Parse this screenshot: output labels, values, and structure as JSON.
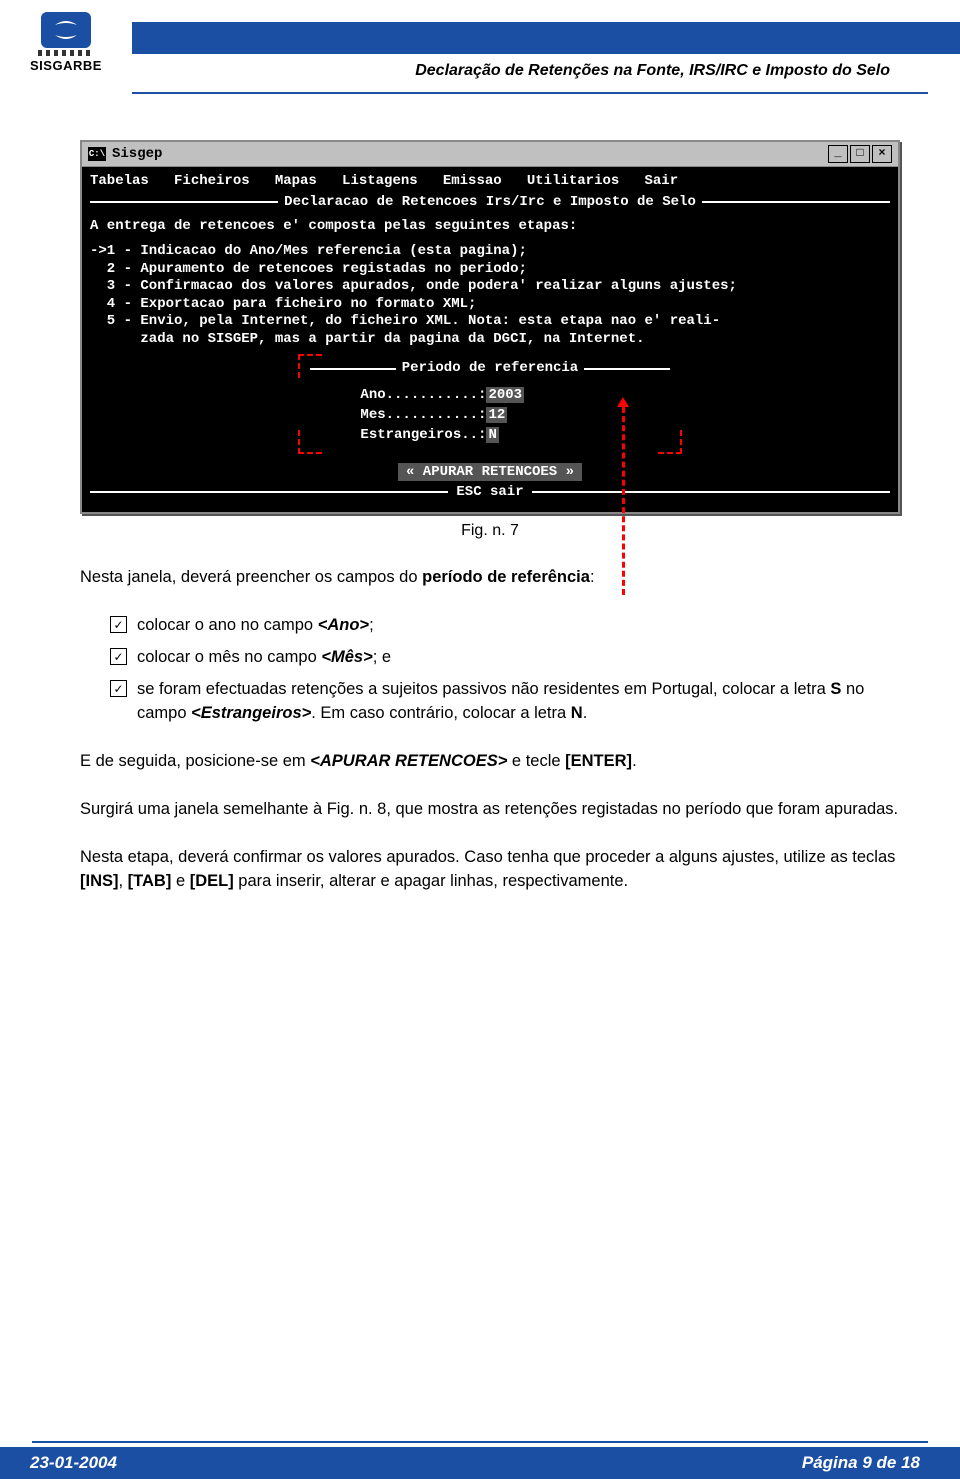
{
  "header": {
    "brand": "SISGARBE",
    "title": "Declaração de Retenções na Fonte, IRS/IRC e Imposto do Selo"
  },
  "terminal": {
    "window_title": "Sisgep",
    "minimize": "_",
    "maximize": "□",
    "close": "×",
    "menu": "Tabelas   Ficheiros   Mapas   Listagens   Emissao   Utilitarios   Sair",
    "panel_title": "Declaracao de Retencoes Irs/Irc e Imposto de Selo",
    "intro": "A entrega de retencoes e' composta pelas seguintes etapas:",
    "steps": "->1 - Indicacao do Ano/Mes referencia (esta pagina);\n  2 - Apuramento de retencoes registadas no periodo;\n  3 - Confirmacao dos valores apurados, onde podera' realizar alguns ajustes;\n  4 - Exportacao para ficheiro no formato XML;\n  5 - Envio, pela Internet, do ficheiro XML. Nota: esta etapa nao e' reali-\n      zada no SISGEP, mas a partir da pagina da DGCI, na Internet.",
    "box_title": "Periodo de referencia",
    "row_ano_label": "Ano...........:",
    "row_ano_val": "2003",
    "row_mes_label": "Mes...........:",
    "row_mes_val": "12",
    "row_est_label": "Estrangeiros..:",
    "row_est_val": "N",
    "apurar": "« APURAR RETENCOES »",
    "esc": "ESC sair"
  },
  "caption": "Fig. n. 7",
  "body": {
    "intro_pre": "Nesta janela, deverá preencher os campos do ",
    "intro_bold": "período de referência",
    "intro_post": ":",
    "item1_pre": "colocar o ano no campo ",
    "item1_bold": "<Ano>",
    "item1_post": ";",
    "item2_pre": "colocar o mês no campo ",
    "item2_bold": "<Mês>",
    "item2_post": "; e",
    "item3_pre": "se foram efectuadas retenções a sujeitos passivos não residentes em Portugal, colocar a letra ",
    "item3_b1": "S",
    "item3_mid": " no campo ",
    "item3_b2": "<Estrangeiros>",
    "item3_post1": ". Em caso contrário, colocar a letra ",
    "item3_b3": "N",
    "item3_post2": ".",
    "p2_pre": "E de seguida, posicione-se em ",
    "p2_b1": "<APURAR RETENCOES>",
    "p2_mid": " e tecle ",
    "p2_b2": "[ENTER]",
    "p2_post": ".",
    "p3": "Surgirá uma janela semelhante à Fig. n. 8, que mostra as retenções registadas no período que foram apuradas.",
    "p4_pre": "Nesta etapa, deverá confirmar os valores apurados. Caso tenha que proceder a alguns ajustes, utilize as teclas ",
    "p4_b1": "[INS]",
    "p4_s1": ", ",
    "p4_b2": "[TAB]",
    "p4_s2": " e ",
    "p4_b3": "[DEL]",
    "p4_post": " para inserir, alterar e apagar linhas, respectivamente."
  },
  "footer": {
    "date": "23-01-2004",
    "page": "Página 9 de 18"
  }
}
